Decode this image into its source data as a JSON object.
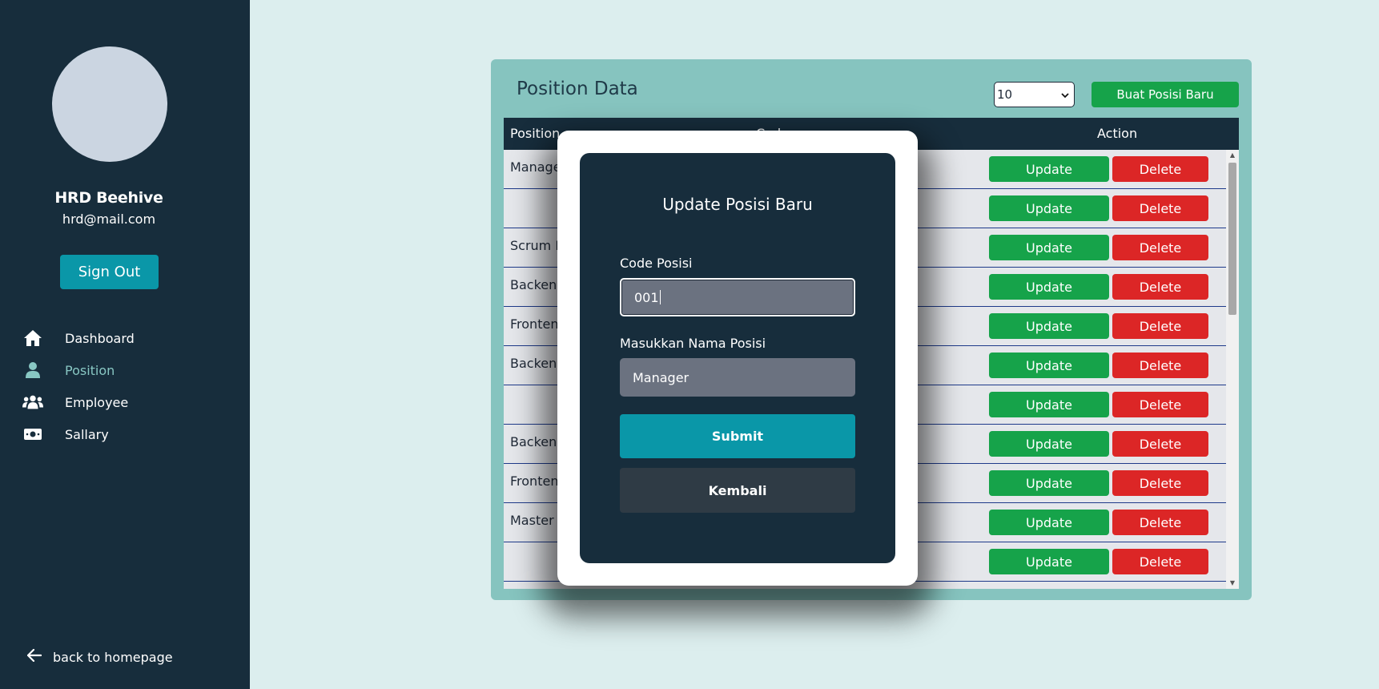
{
  "sidebar": {
    "user": {
      "name": "HRD Beehive",
      "email": "hrd@mail.com"
    },
    "signout_label": "Sign Out",
    "nav": [
      {
        "label": "Dashboard",
        "icon": "home-icon",
        "active": false
      },
      {
        "label": "Position",
        "icon": "user-icon",
        "active": true
      },
      {
        "label": "Employee",
        "icon": "users-icon",
        "active": false
      },
      {
        "label": "Sallary",
        "icon": "money-icon",
        "active": false
      }
    ],
    "back_label": "back to homepage"
  },
  "panel": {
    "title": "Position Data",
    "page_size": "10",
    "create_label": "Buat Posisi Baru",
    "columns": [
      "Position",
      "Code",
      "Action"
    ],
    "rows": [
      {
        "name": "Manager"
      },
      {
        "name": ""
      },
      {
        "name": "Scrum Master"
      },
      {
        "name": "Backend"
      },
      {
        "name": "Frontend"
      },
      {
        "name": "Backend"
      },
      {
        "name": ""
      },
      {
        "name": "Backend"
      },
      {
        "name": "Frontend"
      },
      {
        "name": "Master"
      },
      {
        "name": ""
      }
    ],
    "update_label": "Update",
    "delete_label": "Delete"
  },
  "modal": {
    "title": "Update Posisi Baru",
    "code_label": "Code Posisi",
    "code_value": "001",
    "name_label": "Masukkan Nama Posisi",
    "name_value": "Manager",
    "submit_label": "Submit",
    "back_label": "Kembali"
  },
  "colors": {
    "sidebar": "#172d3c",
    "accent": "#0a97a8",
    "update": "#16a34a",
    "delete": "#dc2626",
    "panel": "#86c4bf",
    "background": "#dceeee"
  }
}
